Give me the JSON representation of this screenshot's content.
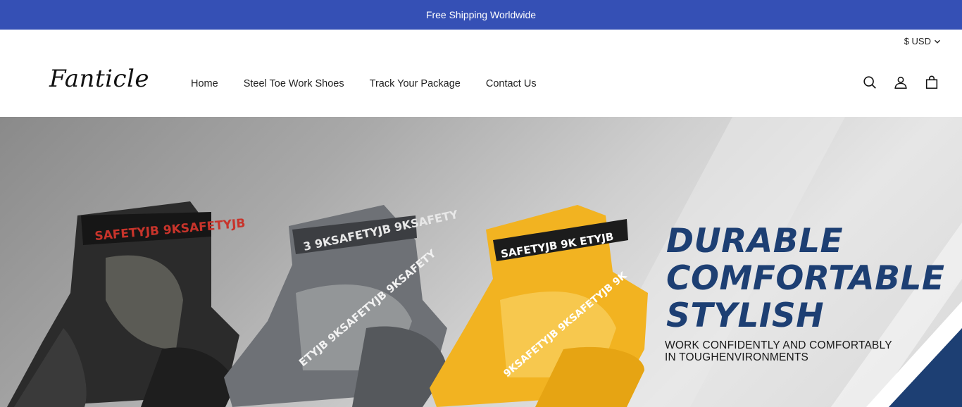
{
  "announcement": "Free Shipping Worldwide",
  "currency": "$ USD",
  "logo": "Fanticle",
  "nav": [
    "Home",
    "Steel Toe Work Shoes",
    "Track Your Package",
    "Contact Us"
  ],
  "icons": [
    "search-icon",
    "account-icon",
    "cart-icon"
  ],
  "hero": {
    "headline": [
      "DURABLE",
      "COMFORTABLE",
      "STYLISH"
    ],
    "subline": [
      "WORK CONFIDENTLY AND COMFORTABLY",
      "IN TOUGHENVIRONMENTS"
    ],
    "shoe_brand": "9KSAFETYJB",
    "shoe_colors": [
      "#2b2b2b",
      "#7a7d80",
      "#f2b321"
    ],
    "accent_color": "#1d3f73"
  },
  "colors": {
    "announcement_bg": "#3550b5"
  }
}
